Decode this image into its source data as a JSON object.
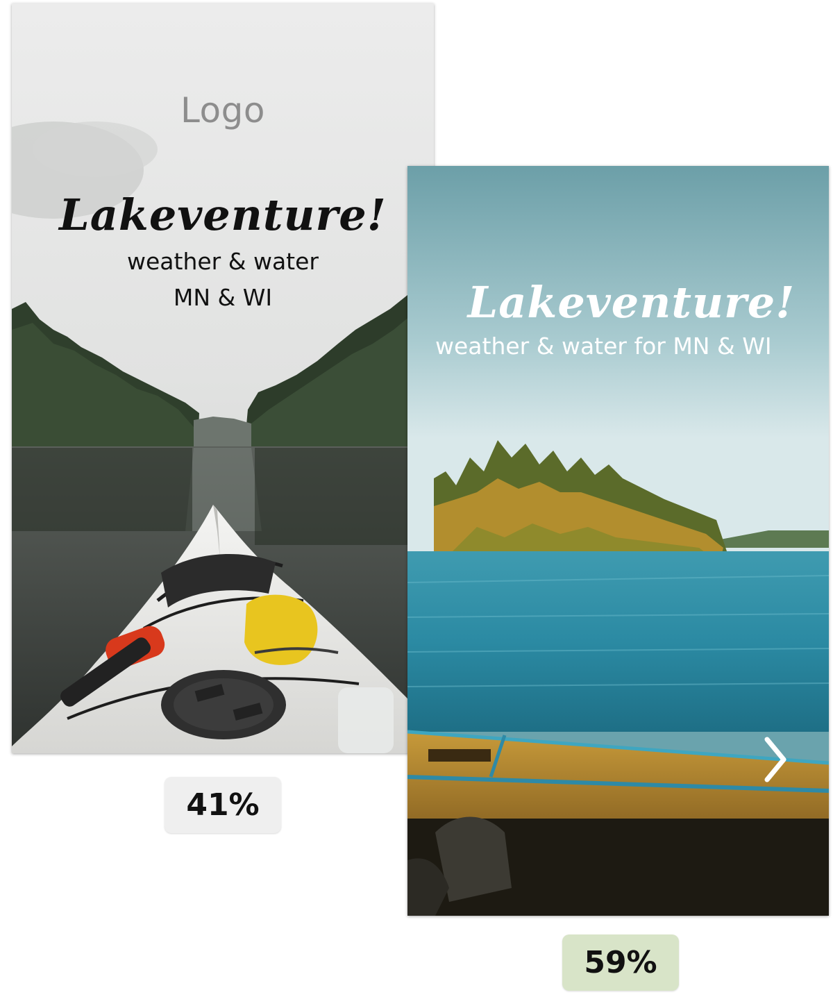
{
  "variant_a": {
    "logo_text": "Logo",
    "brand": "Lakeventure!",
    "tagline_line1": "weather & water",
    "tagline_line2": "MN & WI",
    "image": "kayak-on-calm-lake-photo",
    "result": "41%",
    "badge_color": "#efefef"
  },
  "variant_b": {
    "brand": "Lakeventure!",
    "tagline": "weather & water for MN & WI",
    "image": "canoe-and-island-lake-photo",
    "next_icon": "chevron-right-icon",
    "result": "59%",
    "badge_color": "#d8e4c8"
  }
}
